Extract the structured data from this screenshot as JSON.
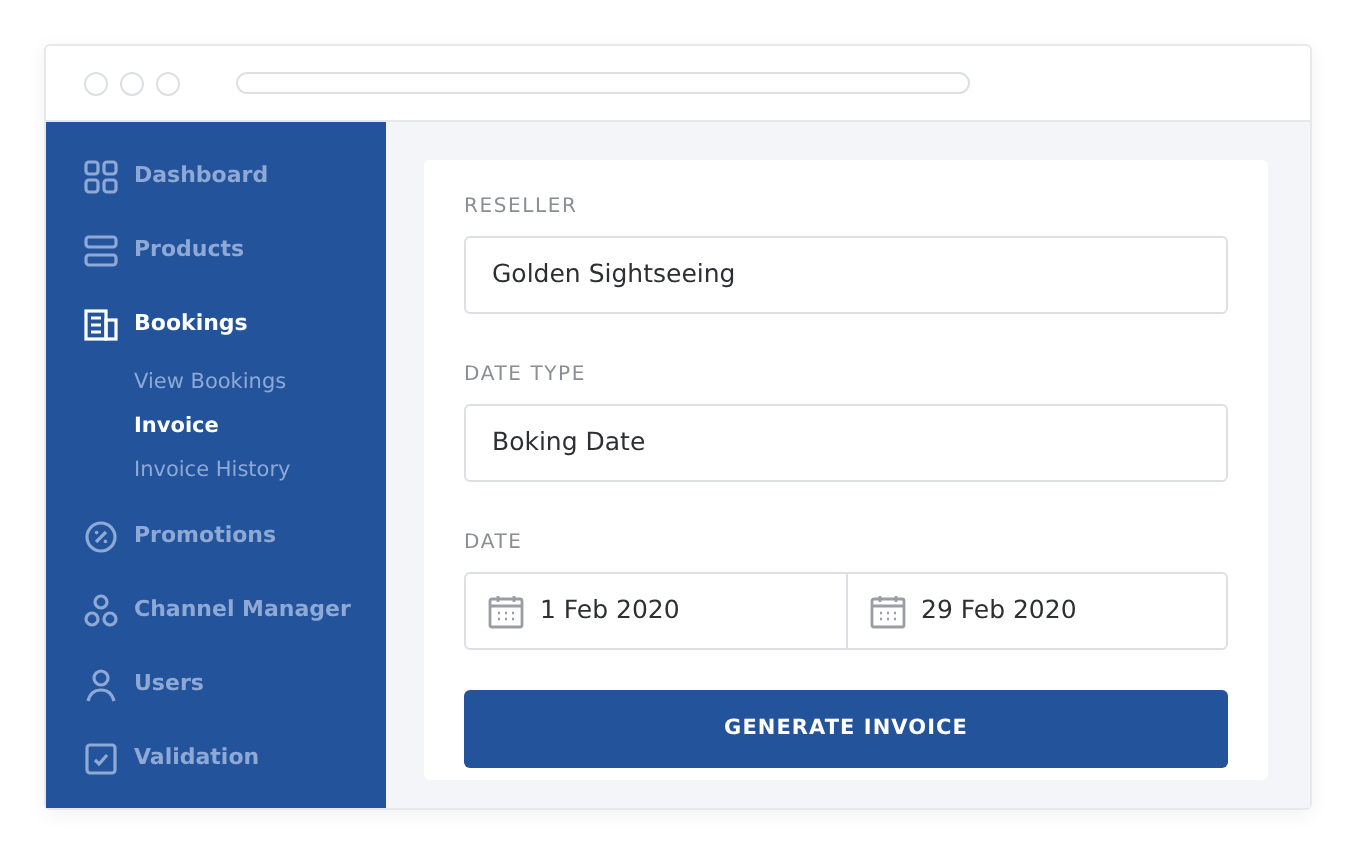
{
  "sidebar": {
    "items": [
      {
        "label": "Dashboard",
        "selected": false
      },
      {
        "label": "Products",
        "selected": false
      },
      {
        "label": "Bookings",
        "selected": true,
        "children": [
          {
            "label": "View Bookings",
            "selected": false
          },
          {
            "label": "Invoice",
            "selected": true
          },
          {
            "label": "Invoice History",
            "selected": false
          }
        ]
      },
      {
        "label": "Promotions",
        "selected": false
      },
      {
        "label": "Channel Manager",
        "selected": false
      },
      {
        "label": "Users",
        "selected": false
      },
      {
        "label": "Validation",
        "selected": false
      }
    ]
  },
  "form": {
    "fields": [
      {
        "kind": "text",
        "label": "RESELLER",
        "value": "Golden Sightseeing"
      },
      {
        "kind": "text",
        "label": "DATE TYPE",
        "value": "Boking Date"
      },
      {
        "kind": "date_range",
        "label": "DATE",
        "values": [
          "1 Feb 2020",
          "29 Feb 2020"
        ]
      }
    ],
    "button": "GENERATE INVOICE"
  }
}
